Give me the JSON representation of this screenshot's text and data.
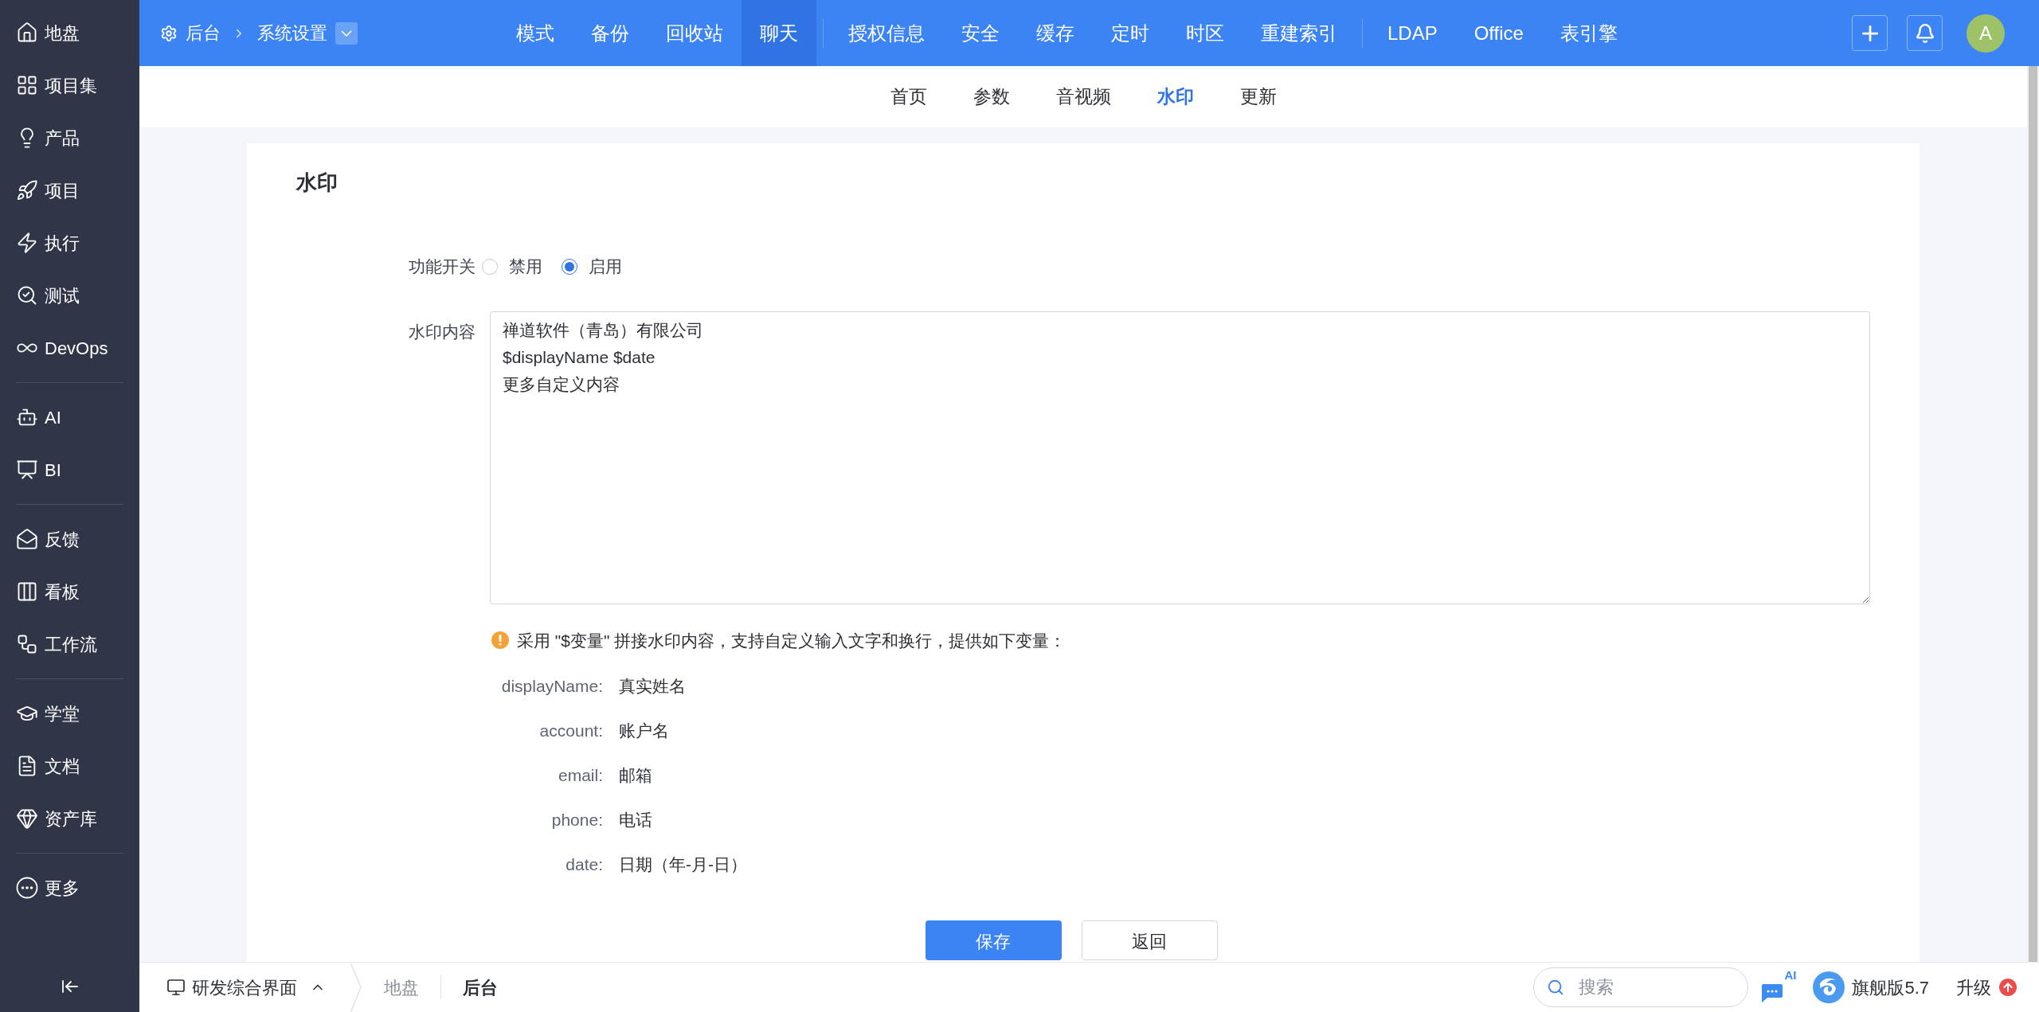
{
  "sidebar": {
    "groups": [
      [
        {
          "label": "地盘"
        },
        {
          "label": "项目集"
        },
        {
          "label": "产品"
        },
        {
          "label": "项目"
        },
        {
          "label": "执行"
        },
        {
          "label": "测试"
        },
        {
          "label": "DevOps"
        }
      ],
      [
        {
          "label": "AI"
        },
        {
          "label": "BI"
        }
      ],
      [
        {
          "label": "反馈"
        },
        {
          "label": "看板"
        },
        {
          "label": "工作流"
        }
      ],
      [
        {
          "label": "学堂"
        },
        {
          "label": "文档"
        },
        {
          "label": "资产库"
        }
      ],
      [
        {
          "label": "更多"
        }
      ]
    ]
  },
  "top_bar": {
    "breadcrumb": {
      "section": "后台",
      "page": "系统设置"
    },
    "tab_groups": [
      [
        {
          "label": "模式",
          "selected": false
        },
        {
          "label": "备份",
          "selected": false
        },
        {
          "label": "回收站",
          "selected": false
        },
        {
          "label": "聊天",
          "selected": true
        }
      ],
      [
        {
          "label": "授权信息",
          "selected": false
        },
        {
          "label": "安全",
          "selected": false
        },
        {
          "label": "缓存",
          "selected": false
        },
        {
          "label": "定时",
          "selected": false
        },
        {
          "label": "时区",
          "selected": false
        },
        {
          "label": "重建索引",
          "selected": false
        }
      ],
      [
        {
          "label": "LDAP",
          "selected": false
        },
        {
          "label": "Office",
          "selected": false
        },
        {
          "label": "表引擎",
          "selected": false
        }
      ]
    ],
    "avatar": "A"
  },
  "sub_tabs": [
    {
      "label": "首页",
      "selected": false
    },
    {
      "label": "参数",
      "selected": false
    },
    {
      "label": "音视频",
      "selected": false
    },
    {
      "label": "水印",
      "selected": true
    },
    {
      "label": "更新",
      "selected": false
    }
  ],
  "form": {
    "title": "水印",
    "switch": {
      "label": "功能开关",
      "options": [
        {
          "label": "禁用",
          "selected": false
        },
        {
          "label": "启用",
          "selected": true
        }
      ]
    },
    "content": {
      "label": "水印内容",
      "value": "禅道软件（青岛）有限公司\n$displayName $date\n更多自定义内容"
    },
    "hint": "采用 \"$变量\" 拼接水印内容，支持自定义输入文字和换行，提供如下变量：",
    "variables": [
      {
        "name": "displayName:",
        "meaning": "真实姓名"
      },
      {
        "name": "account:",
        "meaning": "账户名"
      },
      {
        "name": "email:",
        "meaning": "邮箱"
      },
      {
        "name": "phone:",
        "meaning": "电话"
      },
      {
        "name": "date:",
        "meaning": "日期（年-月-日）"
      }
    ],
    "buttons": [
      {
        "label": "保存",
        "kind": "primary"
      },
      {
        "label": "返回",
        "kind": "default"
      }
    ]
  },
  "bottom_bar": {
    "workspace": "研发综合界面",
    "crumbs": [
      {
        "label": "地盘",
        "selected": false
      },
      {
        "label": "后台",
        "selected": true
      }
    ],
    "search": {
      "placeholder": "搜索"
    },
    "ai_label": "AI",
    "edition": "旗舰版5.7",
    "upgrade": "升级"
  }
}
